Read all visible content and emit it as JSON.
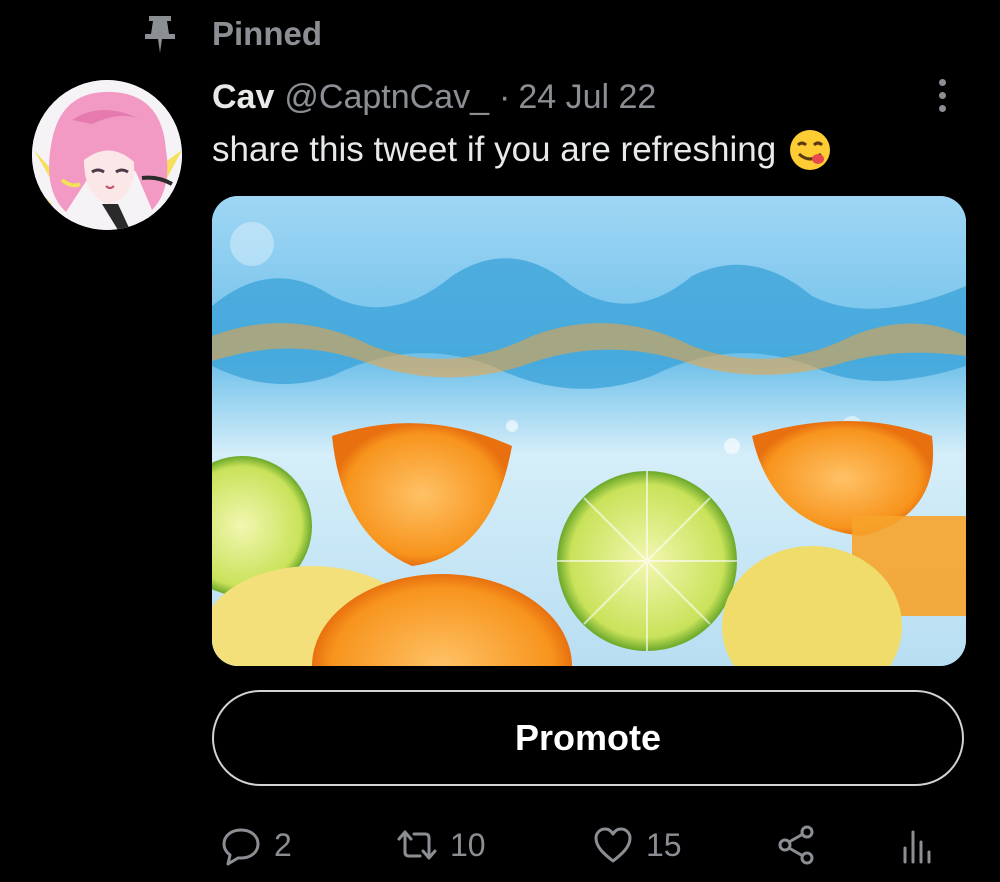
{
  "pinned": {
    "label": "Pinned",
    "icon": "pin-icon"
  },
  "tweet": {
    "author_name": "Cav",
    "author_handle": "@CaptnCav_",
    "separator": "·",
    "date": "24 Jul 22",
    "text": "share this tweet if you are refreshing",
    "emoji": "face-savoring-food-emoji",
    "avatar": "pink-haired-anime-avatar",
    "media": "citrus-fruits-splashing-in-water-photo"
  },
  "promote": {
    "label": "Promote"
  },
  "actions": {
    "reply": {
      "icon": "reply-icon",
      "count": "2"
    },
    "retweet": {
      "icon": "retweet-icon",
      "count": "10"
    },
    "like": {
      "icon": "heart-icon",
      "count": "15"
    },
    "share": {
      "icon": "share-icon"
    },
    "analytics": {
      "icon": "analytics-icon"
    }
  },
  "colors": {
    "background": "#000000",
    "primary_text": "#e7e9ea",
    "secondary_text": "#8b8f94",
    "button_border": "#cfd3d6"
  }
}
